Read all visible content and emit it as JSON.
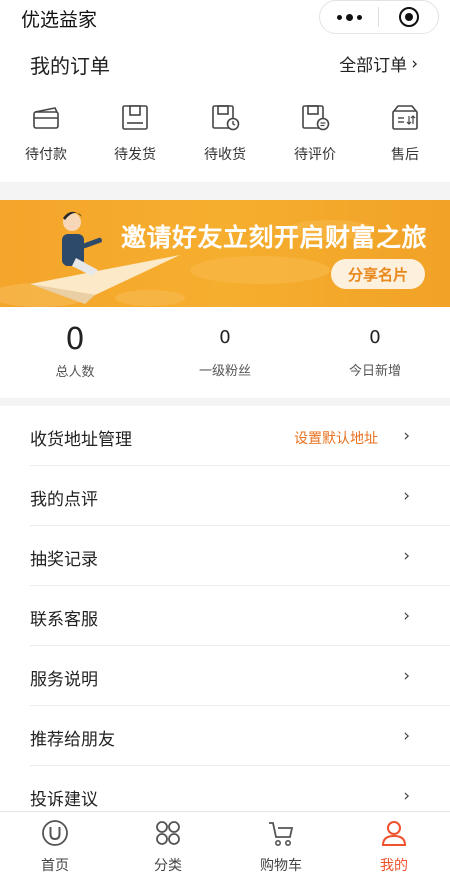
{
  "header": {
    "title": "优选益家",
    "icons": {
      "more": "more-dots-icon",
      "close": "target-close-icon"
    }
  },
  "orders": {
    "title": "我的订单",
    "all_label": "全部订单",
    "chevron": "›",
    "statuses": [
      {
        "label": "待付款",
        "icon": "wallet-icon"
      },
      {
        "label": "待发货",
        "icon": "package-icon"
      },
      {
        "label": "待收货",
        "icon": "delivery-clock-icon"
      },
      {
        "label": "待评价",
        "icon": "comment-box-icon"
      },
      {
        "label": "售后",
        "icon": "after-sales-box-icon"
      }
    ]
  },
  "banner": {
    "text": "邀请好友立刻开启财富之旅",
    "button": "分享名片",
    "colors": {
      "background": "#f5a92d",
      "button_text": "#e8871a"
    }
  },
  "stats": [
    {
      "value": "0",
      "label": "总人数"
    },
    {
      "value": "0",
      "label": "一级粉丝"
    },
    {
      "value": "0",
      "label": "今日新增"
    }
  ],
  "menu": [
    {
      "label": "收货地址管理",
      "extra": "设置默认地址"
    },
    {
      "label": "我的点评"
    },
    {
      "label": "抽奖记录"
    },
    {
      "label": "联系客服"
    },
    {
      "label": "服务说明"
    },
    {
      "label": "推荐给朋友"
    },
    {
      "label": "投诉建议"
    }
  ],
  "chevron": "›",
  "tabs": [
    {
      "label": "首页",
      "icon": "home-u-icon"
    },
    {
      "label": "分类",
      "icon": "category-grid-icon"
    },
    {
      "label": "购物车",
      "icon": "cart-icon"
    },
    {
      "label": "我的",
      "icon": "user-icon",
      "active": true
    }
  ],
  "colors": {
    "accent": "#f0522d",
    "orange_text": "#e8711f"
  }
}
